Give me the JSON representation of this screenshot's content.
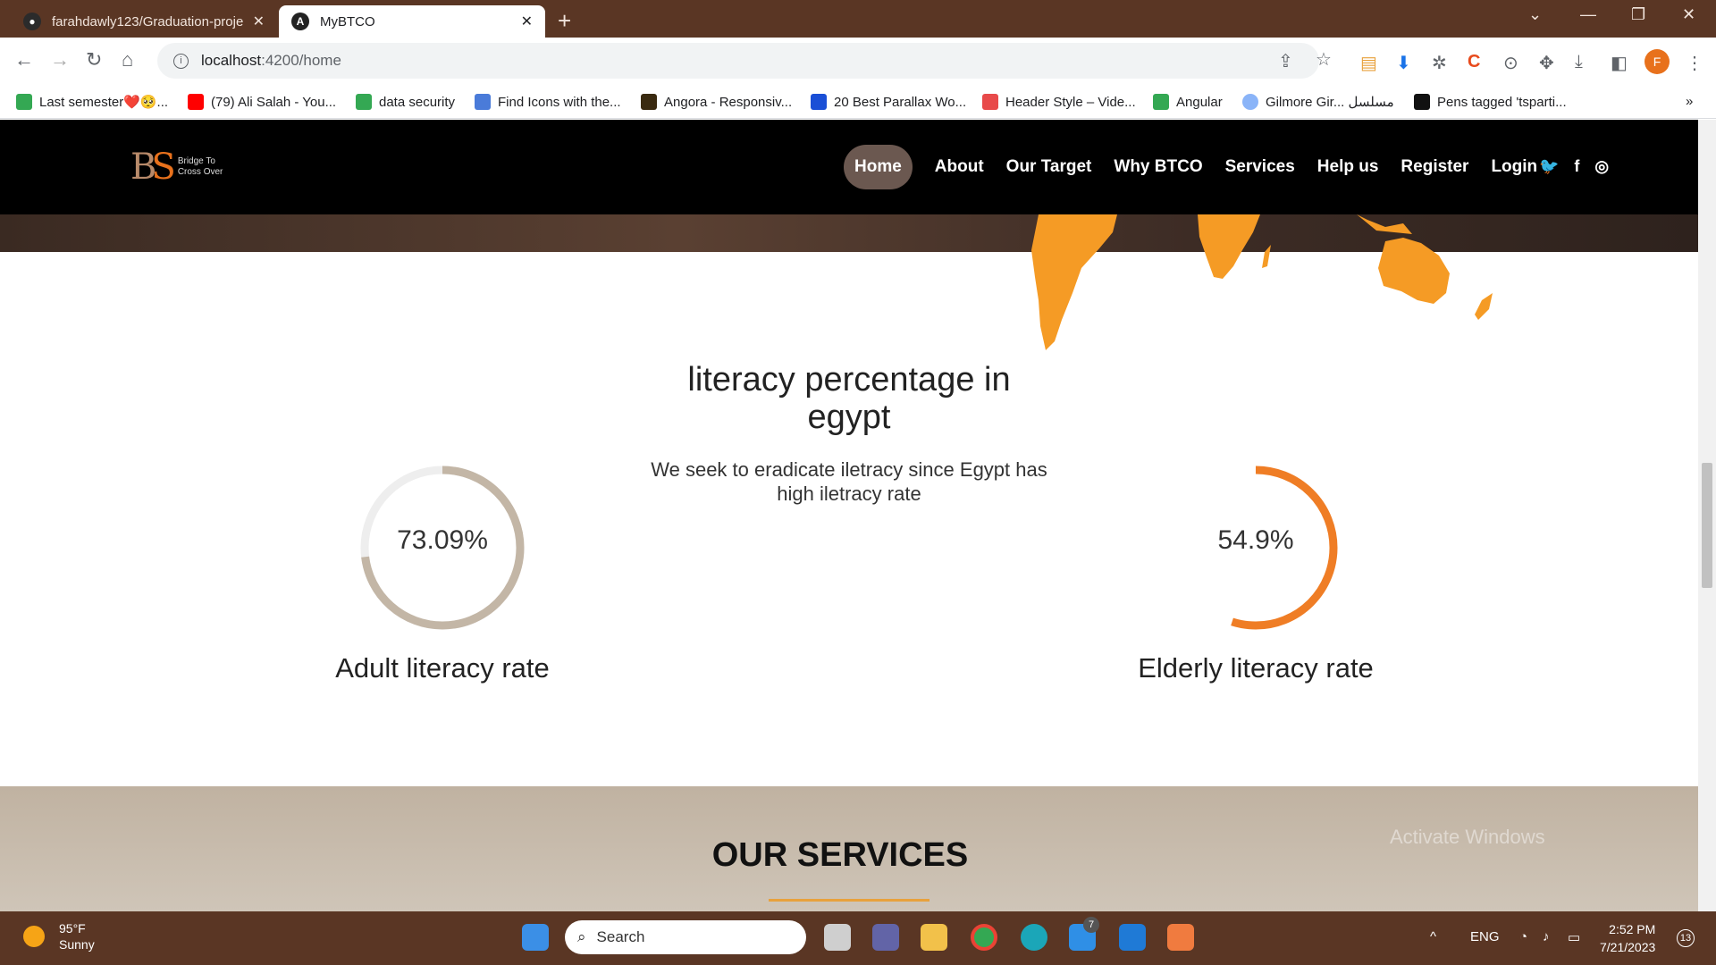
{
  "browser": {
    "tabs": [
      {
        "title": "farahdawly123/Graduation-proje",
        "active": false
      },
      {
        "title": "MyBTCO",
        "active": true
      }
    ],
    "url_host": "localhost",
    "url_rest": ":4200/home",
    "bookmarks": [
      {
        "label": "Last semester❤️🥺...",
        "color": "#34a853"
      },
      {
        "label": "(79) Ali Salah - You...",
        "color": "#ff0000"
      },
      {
        "label": "data security",
        "color": "#34a853"
      },
      {
        "label": "Find Icons with the...",
        "color": "#4a7bd9"
      },
      {
        "label": "Angora - Responsiv...",
        "color": "#3a2a10"
      },
      {
        "label": "20 Best Parallax Wo...",
        "color": "#1a4fd6"
      },
      {
        "label": "Header Style – Vide...",
        "color": "#e84a4a"
      },
      {
        "label": "Angular",
        "color": "#34a853"
      },
      {
        "label": "Gilmore Gir... مسلسل",
        "color": "#8ab4f8"
      },
      {
        "label": "Pens tagged 'tsparti...",
        "color": "#111111"
      }
    ],
    "profile_initial": "F",
    "overflow": "»"
  },
  "site": {
    "logo_text_1": "Bridge To",
    "logo_text_2": "Cross Over",
    "nav": [
      "Home",
      "About",
      "Our Target",
      "Why BTCO",
      "Services",
      "Help us",
      "Register",
      "Login"
    ],
    "active_nav": "Home",
    "socials": [
      "twitter-icon",
      "facebook-icon",
      "instagram-icon"
    ]
  },
  "stats": {
    "adult": {
      "percent_label": "73.09%",
      "value": 73.09,
      "label": "Adult literacy rate",
      "color": "#c3b6a6"
    },
    "elderly": {
      "percent_label": "54.9%",
      "value": 54.9,
      "label": "Elderly literacy rate",
      "color": "#ef7d25"
    },
    "title": "literacy percentage in egypt",
    "description": "We seek to eradicate iletracy since Egypt has high iletracy rate"
  },
  "services": {
    "heading": "OUR SERVICES",
    "watermark": "Activate Windows"
  },
  "taskbar": {
    "weather_temp": "95°F",
    "weather_desc": "Sunny",
    "search_placeholder": "Search",
    "lang": "ENG",
    "time": "2:52 PM",
    "date": "7/21/2023",
    "notification_count": "13",
    "mail_badge": "7"
  }
}
